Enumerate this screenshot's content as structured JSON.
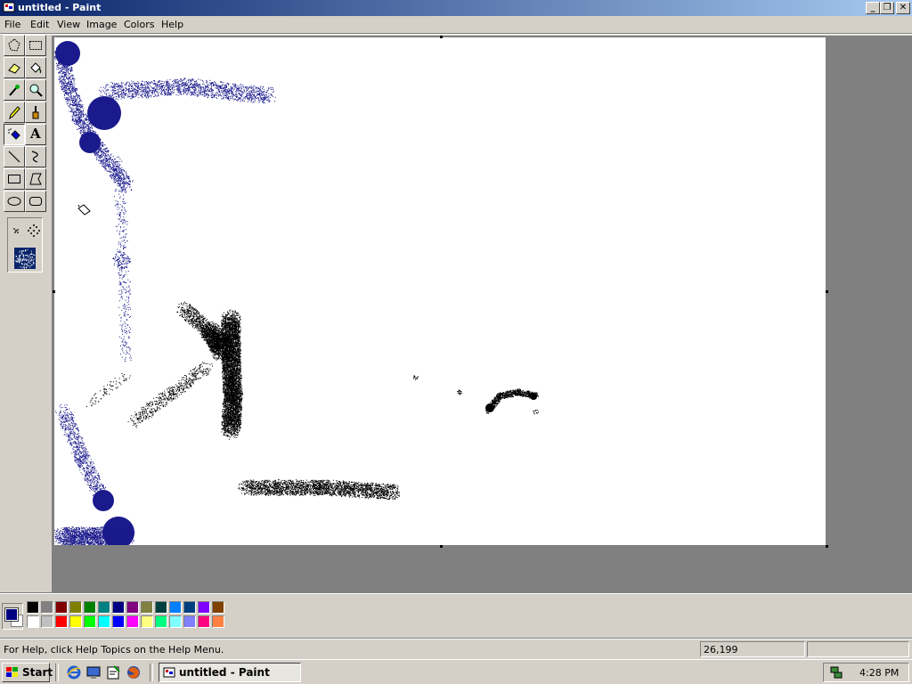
{
  "window": {
    "title": "untitled - Paint"
  },
  "title_buttons": {
    "minimize": "_",
    "restore": "❐",
    "close": "✕"
  },
  "menu": [
    "File",
    "Edit",
    "View",
    "Image",
    "Colors",
    "Help"
  ],
  "tools": [
    "free-form-select-icon",
    "select-icon",
    "eraser-icon",
    "fill-icon",
    "pick-color-icon",
    "magnifier-icon",
    "pencil-icon",
    "brush-icon",
    "airbrush-icon",
    "text-icon",
    "line-icon",
    "curve-icon",
    "rectangle-icon",
    "polygon-icon",
    "ellipse-icon",
    "rounded-rectangle-icon"
  ],
  "active_tool": "airbrush-icon",
  "text_tool_glyph": "A",
  "current_colors": {
    "foreground": "#000080",
    "background": "#ffffff"
  },
  "palette_colors": {
    "top": [
      "#000000",
      "#808080",
      "#800000",
      "#808000",
      "#008000",
      "#008080",
      "#000080",
      "#800080",
      "#808040",
      "#004040",
      "#0080ff",
      "#004080",
      "#8000ff",
      "#804000"
    ],
    "bottom": [
      "#ffffff",
      "#c0c0c0",
      "#ff0000",
      "#ffff00",
      "#00ff00",
      "#00ffff",
      "#0000ff",
      "#ff00ff",
      "#ffff80",
      "#00ff80",
      "#80ffff",
      "#8080ff",
      "#ff0080",
      "#ff8040"
    ]
  },
  "status": {
    "help_text": "For Help, click Help Topics on the Help Menu.",
    "coords": "26,199",
    "size": ""
  },
  "taskbar": {
    "start_label": "Start",
    "quick_launch": [
      "internet-explorer-icon",
      "show-desktop-icon",
      "media-icon",
      "firefox-icon"
    ],
    "task_label": "untitled - Paint",
    "clock": "4:28 PM"
  }
}
